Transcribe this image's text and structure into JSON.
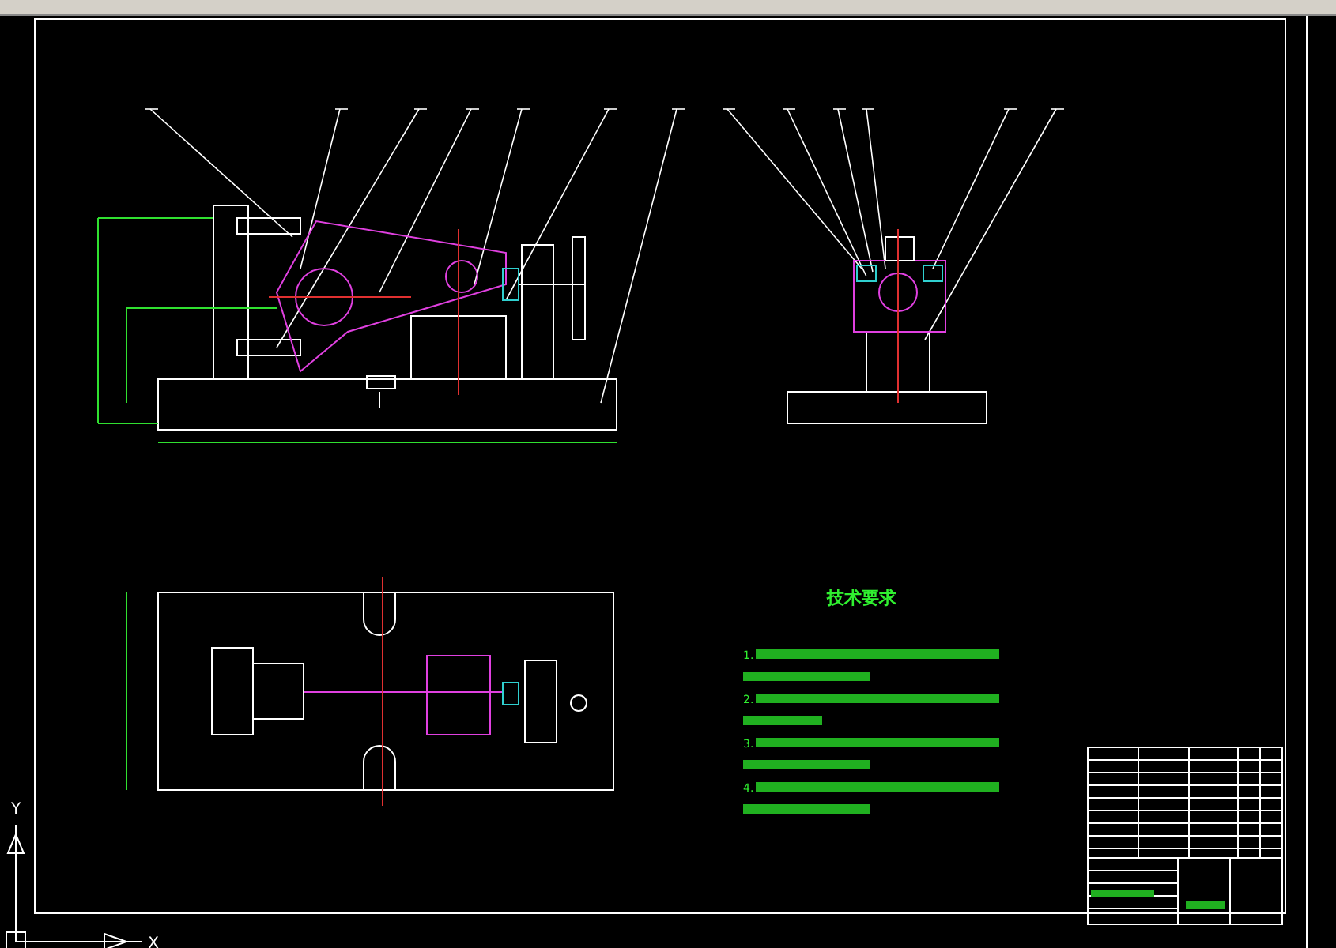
{
  "canvas": {
    "notes_title": "技术要求",
    "notes": [
      {
        "number": "1."
      },
      {
        "number": "2."
      },
      {
        "number": "3."
      },
      {
        "number": "4."
      }
    ],
    "ucs": {
      "y_label": "Y",
      "x_label": "X"
    }
  }
}
